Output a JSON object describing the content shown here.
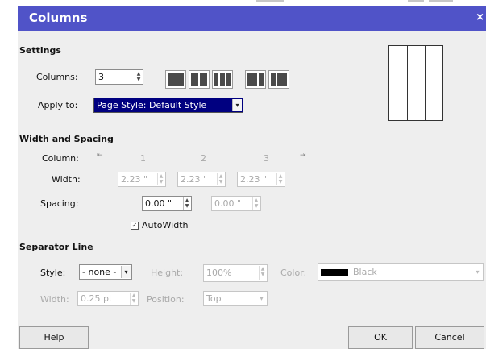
{
  "dialog": {
    "title": "Columns",
    "close_glyph": "×"
  },
  "settings": {
    "heading": "Settings",
    "columns_label": "Columns:",
    "columns_value": "3",
    "apply_label": "Apply to:",
    "apply_value": "Page Style: Default Style",
    "presets": [
      "1 column",
      "2 columns",
      "3 columns",
      "2 columns left",
      "2 columns right"
    ]
  },
  "width_spacing": {
    "heading": "Width and Spacing",
    "column_label": "Column:",
    "column_numbers": [
      "1",
      "2",
      "3"
    ],
    "width_label": "Width:",
    "widths": [
      "2.23 \"",
      "2.23 \"",
      "2.23 \""
    ],
    "spacing_label": "Spacing:",
    "spacings": [
      "0.00 \"",
      "0.00 \""
    ],
    "autowidth_label": "AutoWidth",
    "autowidth_checked": true
  },
  "separator": {
    "heading": "Separator Line",
    "style_label": "Style:",
    "style_value": "- none -",
    "height_label": "Height:",
    "height_value": "100%",
    "color_label": "Color:",
    "color_value": "Black",
    "color_hex": "#000000",
    "width_label": "Width:",
    "width_value": "0.25 pt",
    "position_label": "Position:",
    "position_value": "Top"
  },
  "buttons": {
    "help": "Help",
    "ok": "OK",
    "cancel": "Cancel"
  },
  "theme": {
    "titlebar_color": "#5053c8",
    "selection_color": "#000080",
    "dialog_bg": "#eeeeee"
  }
}
